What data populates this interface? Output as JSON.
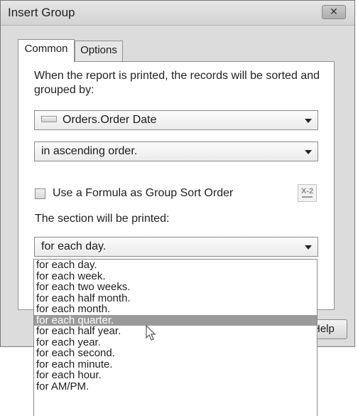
{
  "window": {
    "title": "Insert Group",
    "close_icon": "close-icon",
    "close_glyph": "✕"
  },
  "tabs": [
    {
      "label": "Common"
    },
    {
      "label": "Options"
    }
  ],
  "common": {
    "description": "When the report is printed, the records will be sorted and grouped by:",
    "field_select": {
      "value": "Orders.Order Date",
      "icon": "database-field-icon"
    },
    "order_select": {
      "value": "in ascending order."
    },
    "formula_checkbox": {
      "label": "Use a Formula as Group Sort Order",
      "checked": false
    },
    "formula_button": {
      "label": "X-2",
      "icon": "formula-editor-icon"
    },
    "section_label": "The section will be printed:",
    "section_select": {
      "value": "for each day.",
      "options": [
        "for each day.",
        "for each week.",
        "for each two weeks.",
        "for each half month.",
        "for each month.",
        "for each quarter.",
        "for each half year.",
        "for each year.",
        "for each second.",
        "for each minute.",
        "for each hour.",
        "for AM/PM."
      ],
      "highlighted_index": 5
    }
  },
  "help_button": {
    "label": "Help"
  },
  "colors": {
    "dialog_bg": "#dcdcdc",
    "panel_bg": "#ffffff",
    "highlight": "#9a9a9a"
  }
}
